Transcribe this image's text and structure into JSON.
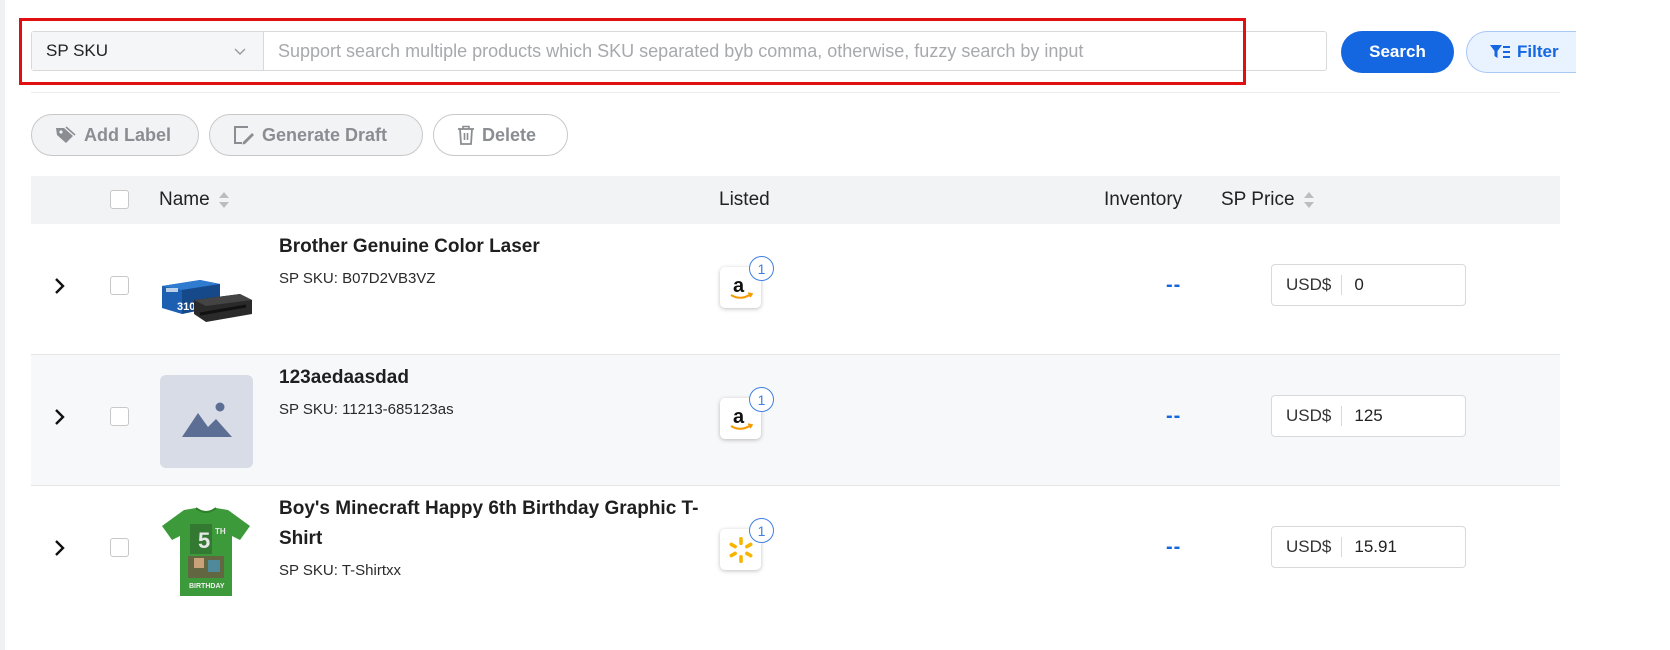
{
  "search": {
    "type_selected": "SP SKU",
    "placeholder": "Support search multiple products which SKU separated byb comma, otherwise, fuzzy search by input",
    "value": "",
    "search_label": "Search",
    "filter_label": "Filter"
  },
  "actions": {
    "add_label": "Add Label",
    "generate_draft": "Generate Draft",
    "delete": "Delete"
  },
  "table": {
    "columns": {
      "name": "Name",
      "listed": "Listed",
      "inventory": "Inventory",
      "sp_price": "SP Price"
    },
    "rows": [
      {
        "name": "Brother Genuine Color Laser",
        "sku": "SP SKU: B07D2VB3VZ",
        "channel_icon": "amazon-icon",
        "channel_count": "1",
        "inventory": "--",
        "currency": "USD$",
        "price": "0",
        "thumb_text": "310"
      },
      {
        "name": "123aedaasdad",
        "sku": "SP SKU: 11213-685123as",
        "channel_icon": "amazon-icon",
        "channel_count": "1",
        "inventory": "--",
        "currency": "USD$",
        "price": "125"
      },
      {
        "name": "Boy's Minecraft Happy 6th Birthday Graphic T-Shirt",
        "sku": "SP SKU: T-Shirtxx",
        "channel_icon": "walmart-icon",
        "channel_count": "1",
        "inventory": "--",
        "currency": "USD$",
        "price": "15.91",
        "thumb_text_top": "TH",
        "thumb_text_bottom": "BIRTHDAY"
      }
    ]
  },
  "colors": {
    "primary": "#1467e0",
    "highlight": "#e01010",
    "header_bg": "#f2f3f5"
  }
}
